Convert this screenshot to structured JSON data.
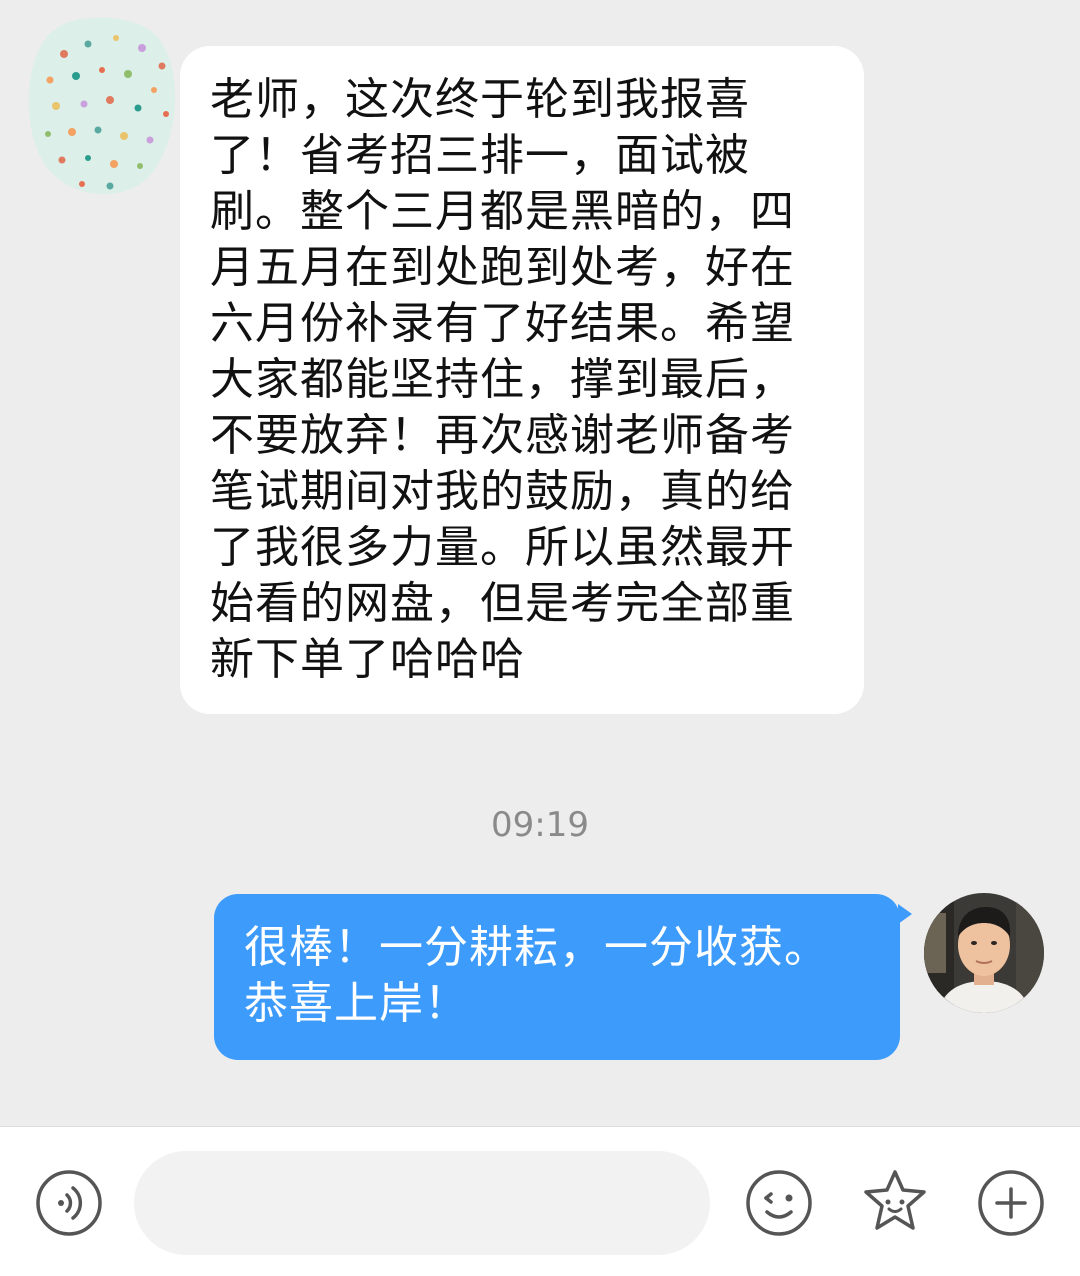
{
  "messages": {
    "incoming": {
      "text": "老师，这次终于轮到我报喜\n了！省考招三排一，面试被\n刷。整个三月都是黑暗的，四\n月五月在到处跑到处考，好在\n六月份补录有了好结果。希望\n大家都能坚持住，撑到最后，\n不要放弃！再次感谢老师备考\n笔试期间对我的鼓励，真的给\n了我很多力量。所以虽然最开\n始看的网盘，但是考完全部重\n新下单了哈哈哈"
    },
    "timestamp": "09:19",
    "outgoing": {
      "text": "很棒！一分耕耘，一分收获。\n恭喜上岸！"
    }
  },
  "input_bar": {
    "placeholder": "",
    "value": "",
    "icons": [
      "voice-icon",
      "emoji-icon",
      "sticker-icon",
      "plus-icon"
    ]
  },
  "colors": {
    "background": "#ededed",
    "incoming_bubble": "#ffffff",
    "outgoing_bubble": "#3c9bfb",
    "timestamp_text": "#8a8a8a",
    "icon_stroke": "#555555"
  }
}
